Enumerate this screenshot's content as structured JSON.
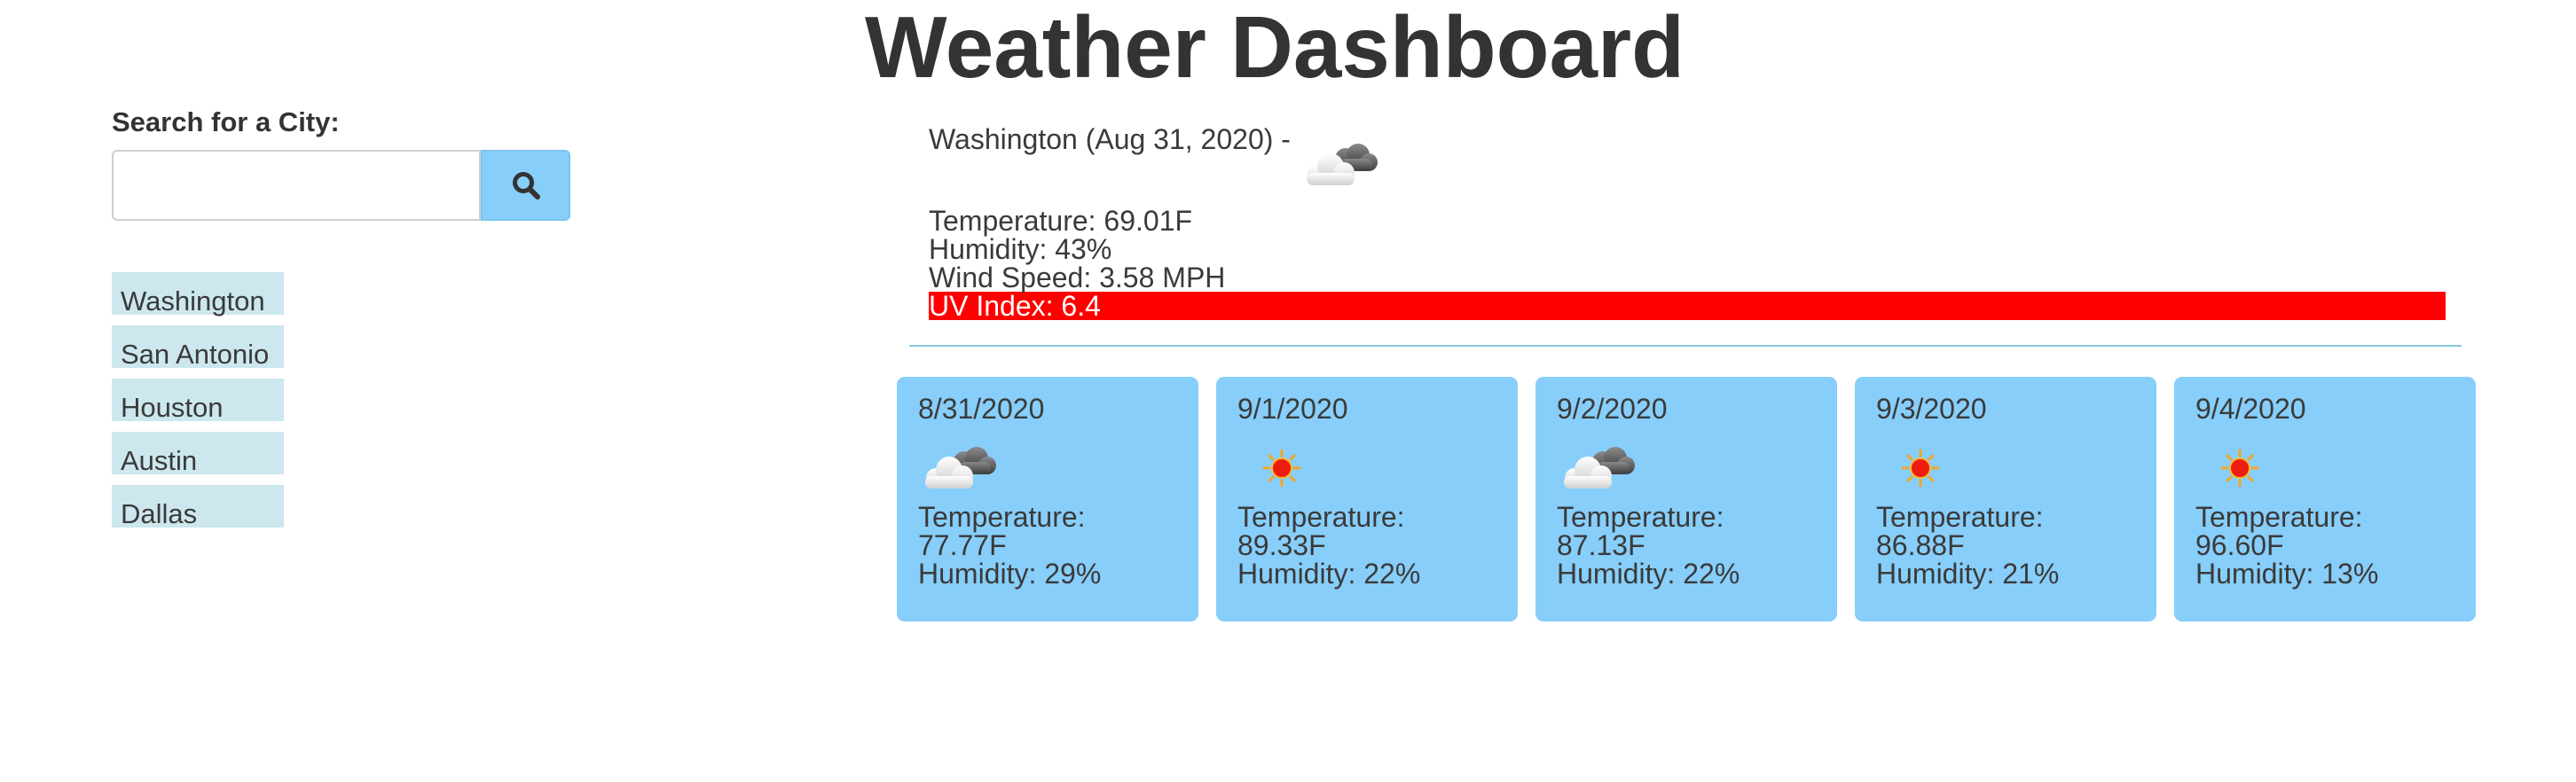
{
  "header": {
    "title": "Weather Dashboard"
  },
  "sidebar": {
    "search_label": "Search for a City:",
    "search_value": "",
    "search_placeholder": "",
    "search_button_icon": "search-icon",
    "history": [
      {
        "label": "Washington"
      },
      {
        "label": "San Antonio"
      },
      {
        "label": "Houston"
      },
      {
        "label": "Austin"
      },
      {
        "label": "Dallas"
      }
    ]
  },
  "current": {
    "city_date": "Washington (Aug 31, 2020) -",
    "icon": "cloudy-icon",
    "temperature": "Temperature: 69.01F",
    "humidity": "Humidity: 43%",
    "wind": "Wind Speed: 3.58 MPH",
    "uv": "UV Index: 6.4",
    "uv_color": "#ff0000"
  },
  "forecast": [
    {
      "date": "8/31/2020",
      "icon": "cloudy-icon",
      "temp_label": "Temperature:",
      "temp_value": "77.77F",
      "humidity": "Humidity: 29%"
    },
    {
      "date": "9/1/2020",
      "icon": "sun-icon",
      "temp_label": "Temperature:",
      "temp_value": "89.33F",
      "humidity": "Humidity: 22%"
    },
    {
      "date": "9/2/2020",
      "icon": "cloudy-icon",
      "temp_label": "Temperature:",
      "temp_value": "87.13F",
      "humidity": "Humidity: 22%"
    },
    {
      "date": "9/3/2020",
      "icon": "sun-icon",
      "temp_label": "Temperature:",
      "temp_value": "86.88F",
      "humidity": "Humidity: 21%"
    },
    {
      "date": "9/4/2020",
      "icon": "sun-icon",
      "temp_label": "Temperature:",
      "temp_value": "96.60F",
      "humidity": "Humidity: 13%"
    }
  ],
  "colors": {
    "card_bg": "#87cefa",
    "history_bg": "#cce7ee",
    "divider": "#8cc6e0"
  }
}
